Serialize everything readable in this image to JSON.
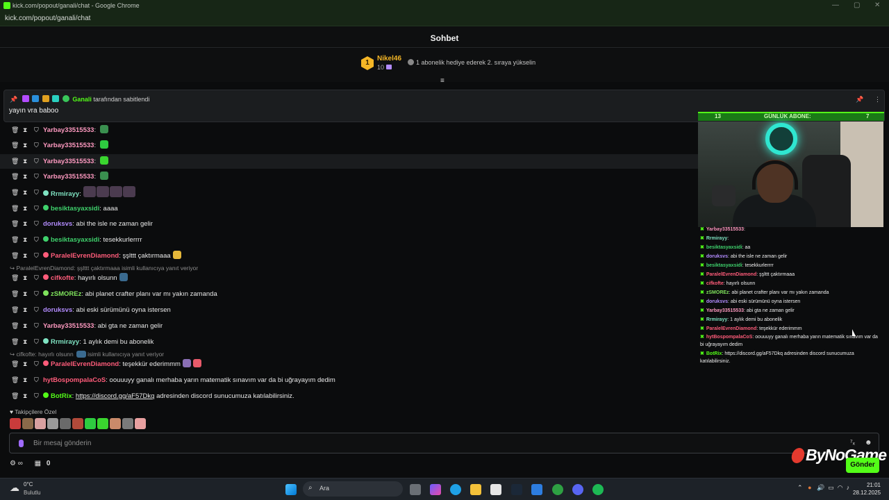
{
  "window": {
    "title": "kick.com/popout/ganali/chat - Google Chrome",
    "url": "kick.com/popout/ganali/chat"
  },
  "header": {
    "title": "Sohbet"
  },
  "leaderboard": {
    "rank": "1",
    "name": "Nikel46",
    "subs": "10",
    "gift_text": "1 abonelik hediye ederek 2. sıraya yükselin"
  },
  "pinned": {
    "pinner": "Ganali",
    "pinned_suffix": "tarafından sabitlendi",
    "text": "yayın vra baboo"
  },
  "messages": [
    {
      "user": "Yarbay33515533",
      "sep": ":",
      "text": "",
      "color": "#ff9ac1",
      "emotes": [
        "#3a8f4f"
      ]
    },
    {
      "user": "Yarbay33515533",
      "sep": ":",
      "text": "",
      "color": "#ff9ac1",
      "emotes": [
        "#2ecc40"
      ]
    },
    {
      "user": "Yarbay33515533",
      "sep": ":",
      "text": "",
      "color": "#ff9ac1",
      "emotes": [
        "#3ad62f"
      ],
      "highlight": true
    },
    {
      "user": "Yarbay33515533",
      "sep": ":",
      "text": "",
      "color": "#ff9ac1",
      "emotes": [
        "#3a8f4f"
      ]
    },
    {
      "user": "Rrmirayy",
      "sep": ":",
      "text": "",
      "color": "#7fe3c2",
      "emotes": [
        "#4b3b4f",
        "#4b3b4f",
        "#4b3b4f",
        "#4b3b4f"
      ]
    },
    {
      "user": "besiktasyaxsidi",
      "sep": ":",
      "text": "aaaa",
      "color": "#3fd16c"
    },
    {
      "user": "doruksvs",
      "sep": ":",
      "text": "abi the isle ne zaman gelir",
      "color": "#b38cff"
    },
    {
      "user": "besiktasyaxsidi",
      "sep": ":",
      "text": "tesekkurlerrrr",
      "color": "#3fd16c"
    },
    {
      "user": "ParalelEvrenDiamond",
      "sep": ":",
      "text": "şşlttt çaktırmaaa",
      "color": "#ff5c7a",
      "emotes": [
        "#e6b83a"
      ]
    },
    {
      "user": "cifkofte",
      "sep": ":",
      "text": "hayırlı olsunn",
      "color": "#ff5c7a",
      "emotes": [
        "#3a6a8f"
      ]
    },
    {
      "user": "zSMOREz",
      "sep": ":",
      "text": "abi planet crafter planı var mı yakın zamanda",
      "color": "#7fe35c"
    },
    {
      "user": "doruksvs",
      "sep": ":",
      "text": "abi eski sürümünü oyna istersen",
      "color": "#b38cff"
    },
    {
      "user": "Yarbay33515533",
      "sep": ":",
      "text": "abi gta ne zaman gelir",
      "color": "#ff9ac1"
    },
    {
      "user": "Rrmirayy",
      "sep": ":",
      "text": "1 aylık demi bu abonelik",
      "color": "#7fe3c2"
    },
    {
      "user": "ParalelEvrenDiamond",
      "sep": ":",
      "text": "teşekkür ederimmm",
      "color": "#ff5c7a",
      "emotes": [
        "#8a6fb5",
        "#e85a6a"
      ]
    },
    {
      "user": "hytBospompalaCoS",
      "sep": ":",
      "text": "oouuuyy ganalı merhaba yarın matematik sınavım var da bi uğrayayım dedim",
      "color": "#ff5c7a"
    },
    {
      "user": "BotRix",
      "sep": ":",
      "text": "adresinden discord sunucumuza katılabilirsiniz.",
      "link": "https://discord.gg/aF57Dkq",
      "color": "#53fc18"
    }
  ],
  "replies": [
    {
      "text": "ParalelEvrenDiamond: şşlttt çaktırmaaa",
      "suffix": "isimli kullanıcıya yanıt veriyor"
    },
    {
      "text": "cifkofte: hayırlı olsunn",
      "suffix": "isimli kullanıcıya yanıt veriyor"
    }
  ],
  "followers_only": "Takipçilere Özel",
  "emote_palette": [
    "#c93b3b",
    "#8a6a4a",
    "#d8a0a0",
    "#9a9a9a",
    "#6a6a6a",
    "#b24a3a",
    "#2ecc40",
    "#3ad62f",
    "#c98a6a",
    "#7a7a7a",
    "#e8a0a0"
  ],
  "input": {
    "placeholder": "Bir mesaj gönderin"
  },
  "footer": {
    "points": "0",
    "send": "Gönder"
  },
  "overlay": {
    "bar_left": "13",
    "bar_title": "GÜNLÜK ABONE:",
    "bar_right": "7",
    "mini_chat": [
      {
        "user": "Yarbay33515533",
        "text": ":",
        "color": "#ff9ac1"
      },
      {
        "user": "Rrmirayy",
        "text": ":",
        "color": "#7fe3c2"
      },
      {
        "user": "besiktasyaxsidi",
        "text": ": aa",
        "color": "#3fd16c"
      },
      {
        "user": "doruksvs",
        "text": ": abi the isle ne zaman gelir",
        "color": "#b38cff"
      },
      {
        "user": "besiktasyaxsidi",
        "text": ": tesekkurlerrrr",
        "color": "#3fd16c"
      },
      {
        "user": "ParalelEvrenDiamond",
        "text": ": şşlttt çaktırmaaa",
        "color": "#ff5c7a"
      },
      {
        "user": "cifkofte",
        "text": ": hayırlı olsunn",
        "color": "#ff5c7a"
      },
      {
        "user": "zSMOREz",
        "text": ": abi planet crafter planı var mı yakın zamanda",
        "color": "#7fe35c"
      },
      {
        "user": "doruksvs",
        "text": ": abi eski sürümünü oyna istersen",
        "color": "#b38cff"
      },
      {
        "user": "Yarbay33515533",
        "text": ": abi gta ne zaman gelir",
        "color": "#ff9ac1"
      },
      {
        "user": "Rrmirayy",
        "text": ": 1 aylık demi bu abonelik",
        "color": "#7fe3c2"
      },
      {
        "user": "ParalelEvrenDiamond",
        "text": ": teşekkür ederimmm",
        "color": "#ff5c7a"
      },
      {
        "user": "hytBospompalaCoS",
        "text": ": oouuuyy ganalı merhaba yarın matematik sınavım var da bi uğrayayım dedim",
        "color": "#ff5c7a",
        "wrap": true
      },
      {
        "user": "BotRix",
        "text": ": https://discord.gg/aF57Dkq adresinden discord sunucumuza katılabilirsiniz.",
        "color": "#53fc18",
        "wrap": true
      }
    ]
  },
  "watermark": "ByNoGame",
  "taskbar": {
    "weather_temp": "0°C",
    "weather_desc": "Bulutlu",
    "search": "Ara",
    "time": "21:01",
    "date": "28.12.2025"
  },
  "colors": {
    "accent": "#53fc18",
    "bg": "#0b0c0d"
  }
}
